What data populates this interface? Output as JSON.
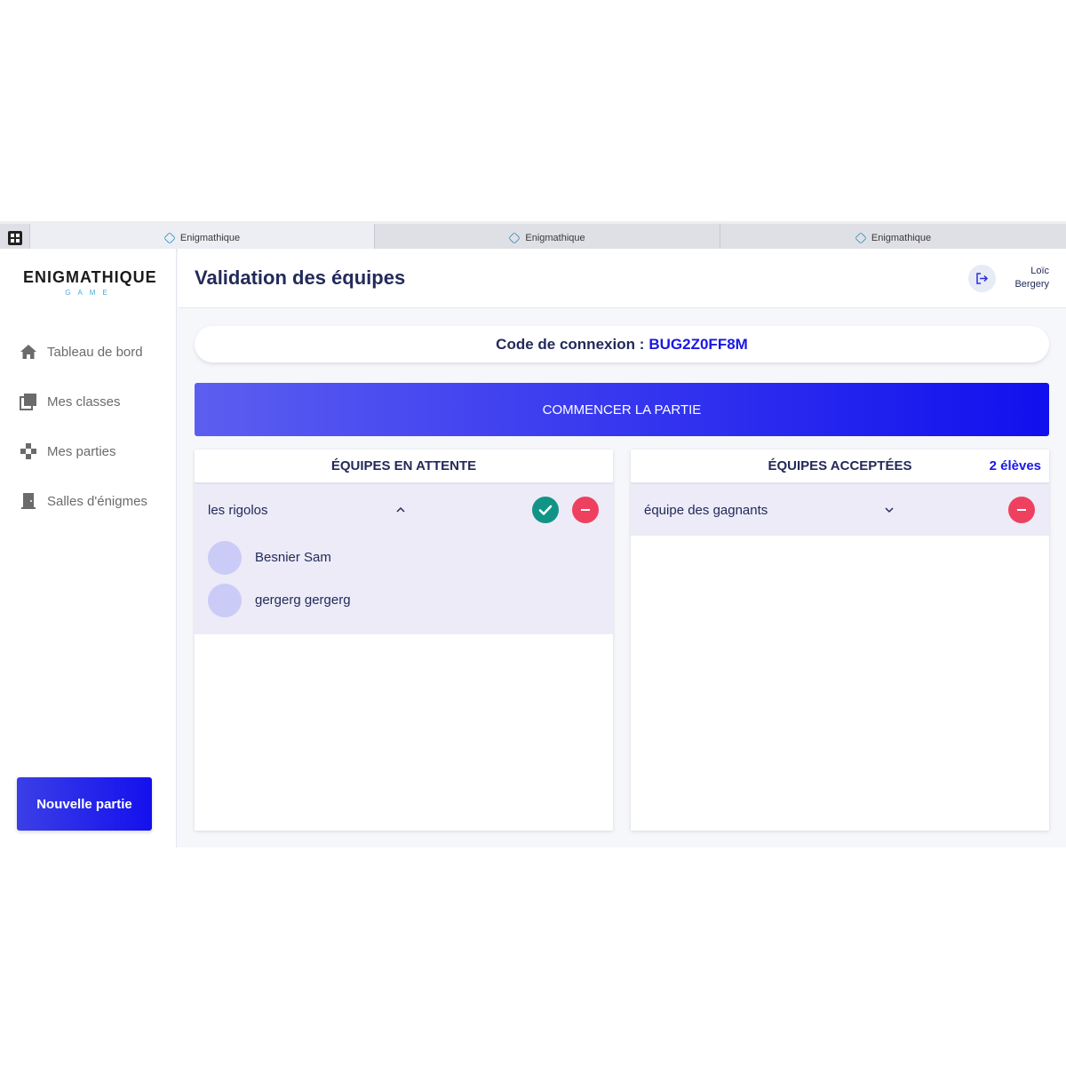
{
  "tabs": [
    {
      "label": "Enigmathique"
    },
    {
      "label": "Enigmathique"
    },
    {
      "label": "Enigmathique"
    }
  ],
  "logo": {
    "main": "ENIGMATHIQUE",
    "sub": "GAME"
  },
  "sidebar": {
    "items": [
      {
        "label": "Tableau de bord",
        "icon": "home-icon"
      },
      {
        "label": "Mes classes",
        "icon": "library-icon"
      },
      {
        "label": "Mes parties",
        "icon": "gamepad-icon"
      },
      {
        "label": "Salles d'énigmes",
        "icon": "door-icon"
      }
    ],
    "new_game_label": "Nouvelle partie"
  },
  "header": {
    "title": "Validation des équipes",
    "user_first": "Loïc",
    "user_last": "Bergery"
  },
  "connection": {
    "label": "Code de connexion :",
    "code": "BUG2Z0FF8M"
  },
  "start_label": "COMMENCER LA PARTIE",
  "waiting": {
    "title": "ÉQUIPES EN ATTENTE",
    "teams": [
      {
        "name": "les rigolos",
        "expanded": true,
        "members": [
          "Besnier Sam",
          "gergerg gergerg"
        ]
      }
    ]
  },
  "accepted": {
    "title": "ÉQUIPES ACCEPTÉES",
    "count": "2 élèves",
    "teams": [
      {
        "name": "équipe des gagnants",
        "expanded": false
      }
    ]
  },
  "colors": {
    "accent": "#1a17e6",
    "accept": "#119485",
    "remove": "#ee4160",
    "team_bg": "#ecebf7"
  }
}
